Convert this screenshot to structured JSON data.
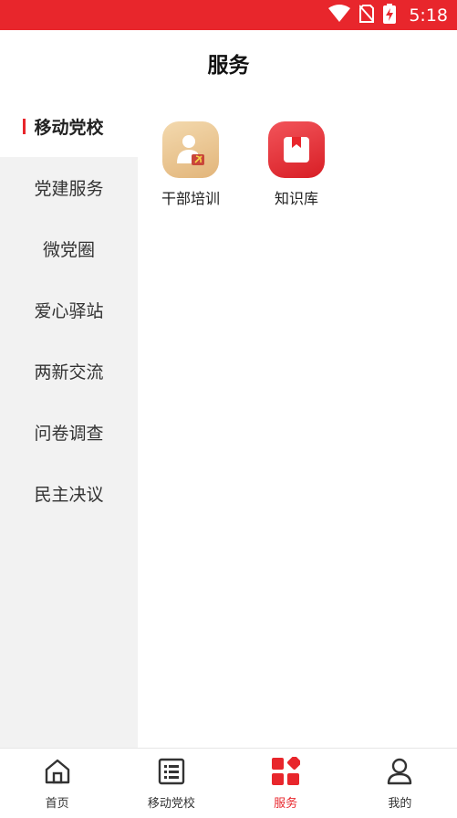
{
  "status_bar": {
    "time": "5:18",
    "icons": [
      "wifi-icon",
      "no-sim-icon",
      "battery-charging-icon"
    ],
    "color": "#e8262c"
  },
  "header": {
    "title": "服务"
  },
  "sidebar": {
    "active_index": 0,
    "items": [
      {
        "label": "移动党校"
      },
      {
        "label": "党建服务"
      },
      {
        "label": "微党圈"
      },
      {
        "label": "爱心驿站"
      },
      {
        "label": "两新交流"
      },
      {
        "label": "问卷调查"
      },
      {
        "label": "民主决议"
      }
    ]
  },
  "services": [
    {
      "label": "干部培训",
      "icon": "cadre-training-icon",
      "color": "#e9c48f"
    },
    {
      "label": "知识库",
      "icon": "knowledge-base-icon",
      "color": "#e8262c"
    }
  ],
  "bottom_nav": {
    "active_index": 2,
    "items": [
      {
        "label": "首页",
        "icon": "home-icon"
      },
      {
        "label": "移动党校",
        "icon": "list-icon"
      },
      {
        "label": "服务",
        "icon": "services-grid-icon"
      },
      {
        "label": "我的",
        "icon": "user-icon"
      }
    ]
  },
  "colors": {
    "accent": "#e8262c",
    "sidebar_bg": "#f2f2f2"
  }
}
